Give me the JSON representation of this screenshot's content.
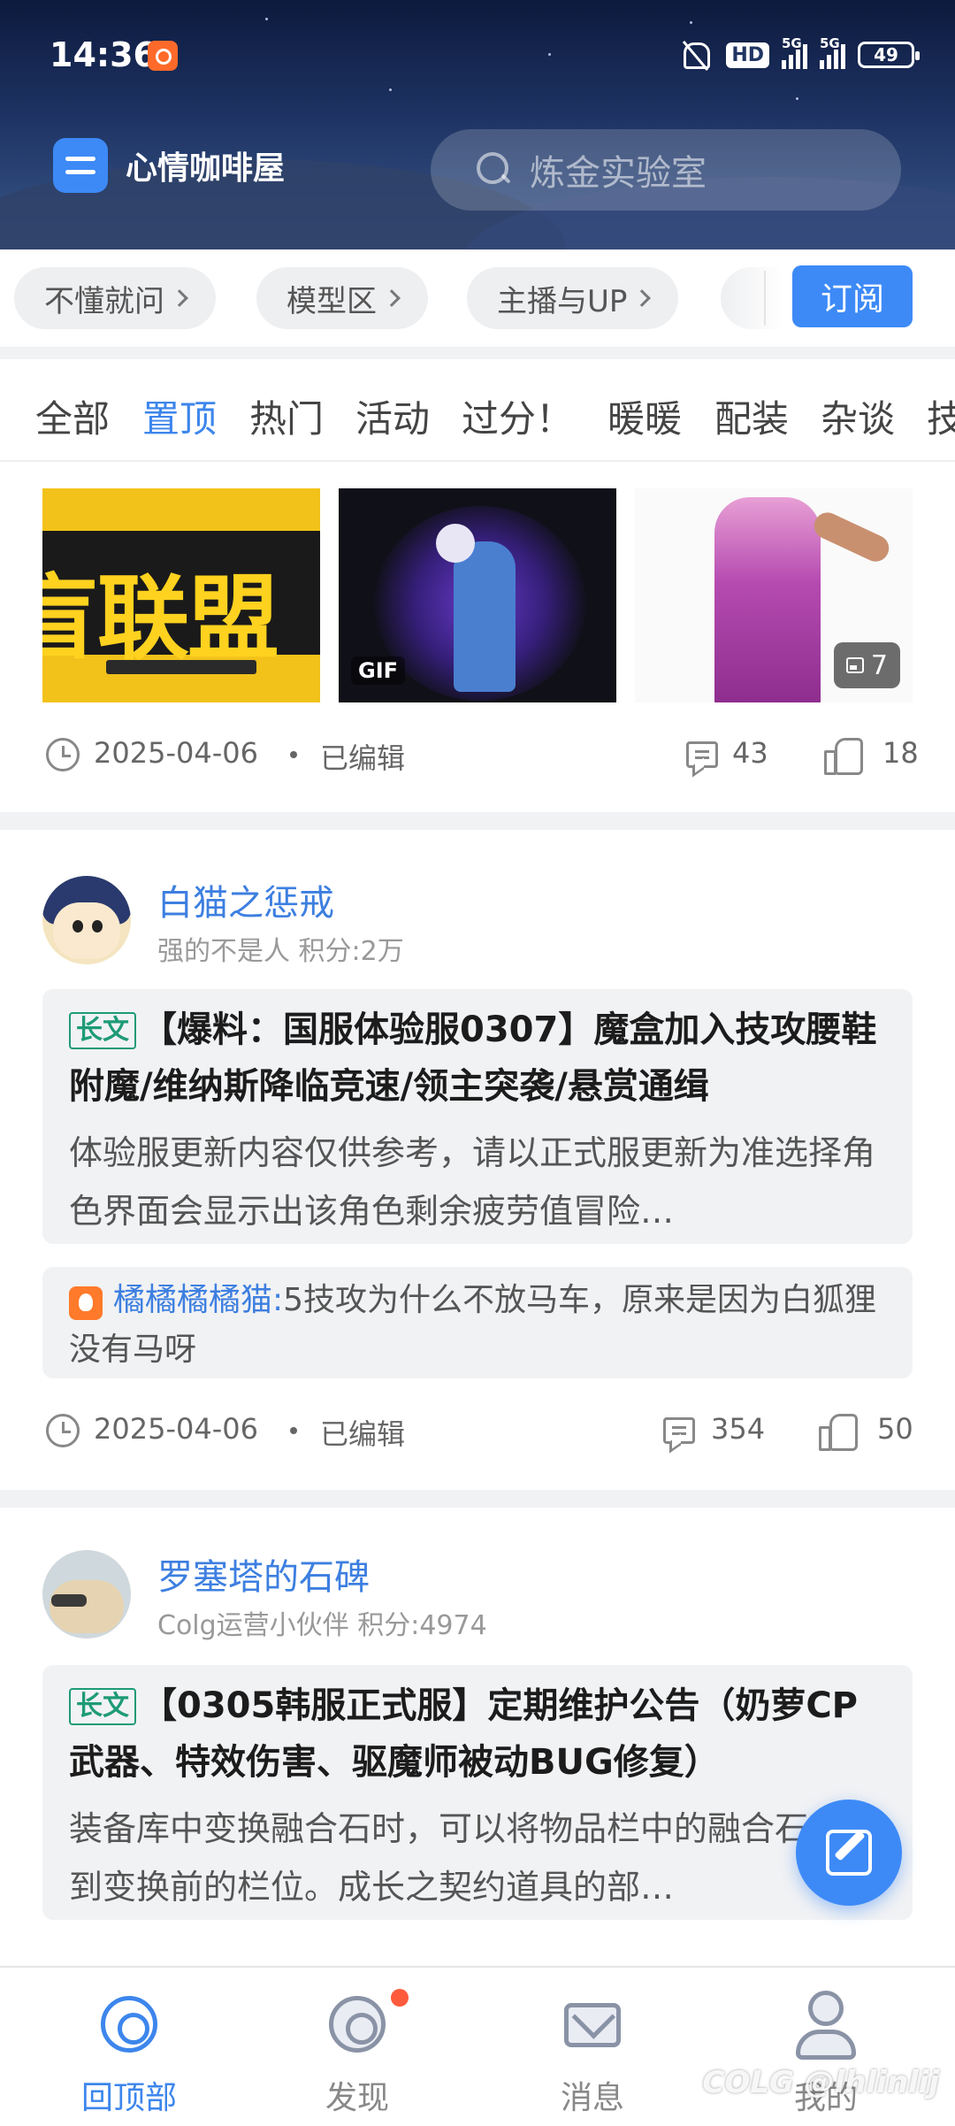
{
  "status_bar": {
    "time": "14:36",
    "hd_label": "HD",
    "sim1_label": "5G",
    "sim2_label": "5G",
    "battery": "49"
  },
  "header": {
    "forum_name": "心情咖啡屋",
    "search_placeholder": "炼金实验室"
  },
  "subforums": {
    "chips": [
      "不懂就问",
      "模型区",
      "主播与UP"
    ],
    "subscribe_label": "订阅"
  },
  "tabs": {
    "items": [
      "全部",
      "置顶",
      "热门",
      "活动",
      "过分！",
      "暖暖",
      "配装",
      "杂谈",
      "技"
    ],
    "active": "置顶"
  },
  "post1": {
    "gif_label": "GIF",
    "image_count": "7",
    "date": "2025-04-06",
    "edited": "已编辑",
    "comments": "43",
    "likes": "18"
  },
  "post2": {
    "author": "白猫之惩戒",
    "author_sub": "强的不是人 积分:2万",
    "tag": "长文",
    "title": "【爆料：国服体验服0307】魔盒加入技攻腰鞋附魔/维纳斯降临竞速/领主突袭/悬赏通缉",
    "excerpt": "体验服更新内容仅供参考，请以正式服更新为准选择角色界面会显示出该角色剩余疲劳值冒险…",
    "hot_user": "橘橘橘橘猫:",
    "hot_comment": "5技攻为什么不放马车，原来是因为白狐狸没有马呀",
    "date": "2025-04-06",
    "edited": "已编辑",
    "comments": "354",
    "likes": "50"
  },
  "post3": {
    "author": "罗塞塔的石碑",
    "author_sub": "Colg运营小伙伴 积分:4974",
    "tag": "长文",
    "title": "【0305韩服正式服】定期维护公告（奶萝CP武器、特效伤害、驱魔师被动BUG修复）",
    "excerpt": "装备库中变换融合石时，可以将物品栏中的融合石变换到变换前的栏位。成长之契约道具的部…"
  },
  "bottom_nav": {
    "items": [
      "回顶部",
      "发现",
      "消息",
      "我的"
    ],
    "active": "回顶部"
  },
  "watermark": "COLG @lhlinlij",
  "colors": {
    "accent": "#3d8af7",
    "header_bg": "#1d3262",
    "long_tag": "#1e9b76",
    "badge_red": "#ff5a3c"
  }
}
